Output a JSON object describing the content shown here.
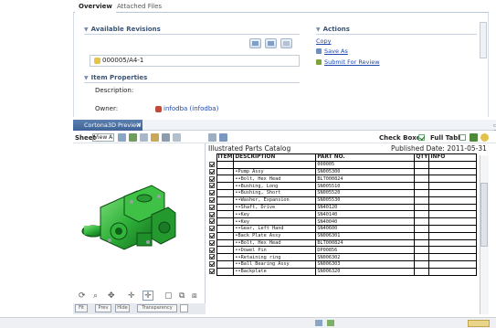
{
  "editor": {
    "tabs": [
      {
        "label": "Overview"
      },
      {
        "label": "Attached Files"
      }
    ],
    "sections": {
      "available_revisions": "Available Revisions",
      "actions": "Actions",
      "item_properties": "Item Properties"
    },
    "revision_value": "000005/A4-1",
    "actions": [
      {
        "label": "Copy"
      },
      {
        "label": "Save As"
      },
      {
        "label": "Submit For Review"
      }
    ],
    "properties": {
      "description_label": "Description:",
      "owner_label": "Owner:",
      "owner_value": "infodba (infodba)"
    }
  },
  "preview": {
    "tab_label": "Cortona3D Preview",
    "close_glyph": "✕",
    "window_glyph": "▭ ▢",
    "toolbar": {
      "sheet_label": "Sheet",
      "view_select": "View A",
      "check_boxes_label": "Check Boxes",
      "full_table_label": "Full Table"
    },
    "viewport_buttons": [
      "Fit",
      "Prev",
      "Hide",
      "Transparency"
    ]
  },
  "catalog": {
    "title": "Illustrated Parts Catalog",
    "published": "Published Date: 2011-05-31",
    "columns": [
      "ITEM",
      "DESCRIPTION",
      "PART NO.",
      "QTY",
      "INFO"
    ],
    "rows": [
      {
        "checked": true,
        "item": "",
        "description": "",
        "part_no": "000005",
        "qty": "",
        "info": ""
      },
      {
        "checked": true,
        "item": "",
        "description": "•Pump Assy",
        "part_no": "SN005300",
        "qty": "",
        "info": ""
      },
      {
        "checked": true,
        "item": "",
        "description": "••Bolt, Hex Head",
        "part_no": "BLT000824",
        "qty": "",
        "info": ""
      },
      {
        "checked": true,
        "item": "",
        "description": "••Bushing, Long",
        "part_no": "SN005510",
        "qty": "",
        "info": ""
      },
      {
        "checked": true,
        "item": "",
        "description": "••Bushing, Short",
        "part_no": "SN005520",
        "qty": "",
        "info": ""
      },
      {
        "checked": true,
        "item": "",
        "description": "••Washer, Expansion",
        "part_no": "SN005530",
        "qty": "",
        "info": ""
      },
      {
        "checked": true,
        "item": "",
        "description": "••Shaft, Drive",
        "part_no": "SN40120",
        "qty": "",
        "info": ""
      },
      {
        "checked": true,
        "item": "",
        "description": "••Key",
        "part_no": "SN40140",
        "qty": "",
        "info": ""
      },
      {
        "checked": true,
        "item": "",
        "description": "••Key",
        "part_no": "SN40040",
        "qty": "",
        "info": ""
      },
      {
        "checked": true,
        "item": "",
        "description": "••Gear, Left Hand",
        "part_no": "SN40600",
        "qty": "",
        "info": ""
      },
      {
        "checked": true,
        "item": "",
        "description": "•Back Plate Assy",
        "part_no": "SN006301",
        "qty": "",
        "info": ""
      },
      {
        "checked": true,
        "item": "",
        "description": "••Bolt, Hex Head",
        "part_no": "BLT000824",
        "qty": "",
        "info": ""
      },
      {
        "checked": true,
        "item": "",
        "description": "••Dowel Pin",
        "part_no": "DP00856",
        "qty": "",
        "info": ""
      },
      {
        "checked": true,
        "item": "",
        "description": "••Retaining ring",
        "part_no": "SN006302",
        "qty": "",
        "info": ""
      },
      {
        "checked": true,
        "item": "",
        "description": "••Ball Bearing Assy",
        "part_no": "SN006303",
        "qty": "",
        "info": ""
      },
      {
        "checked": true,
        "item": "",
        "description": "••Backplate",
        "part_no": "SN006320",
        "qty": "",
        "info": ""
      }
    ]
  }
}
